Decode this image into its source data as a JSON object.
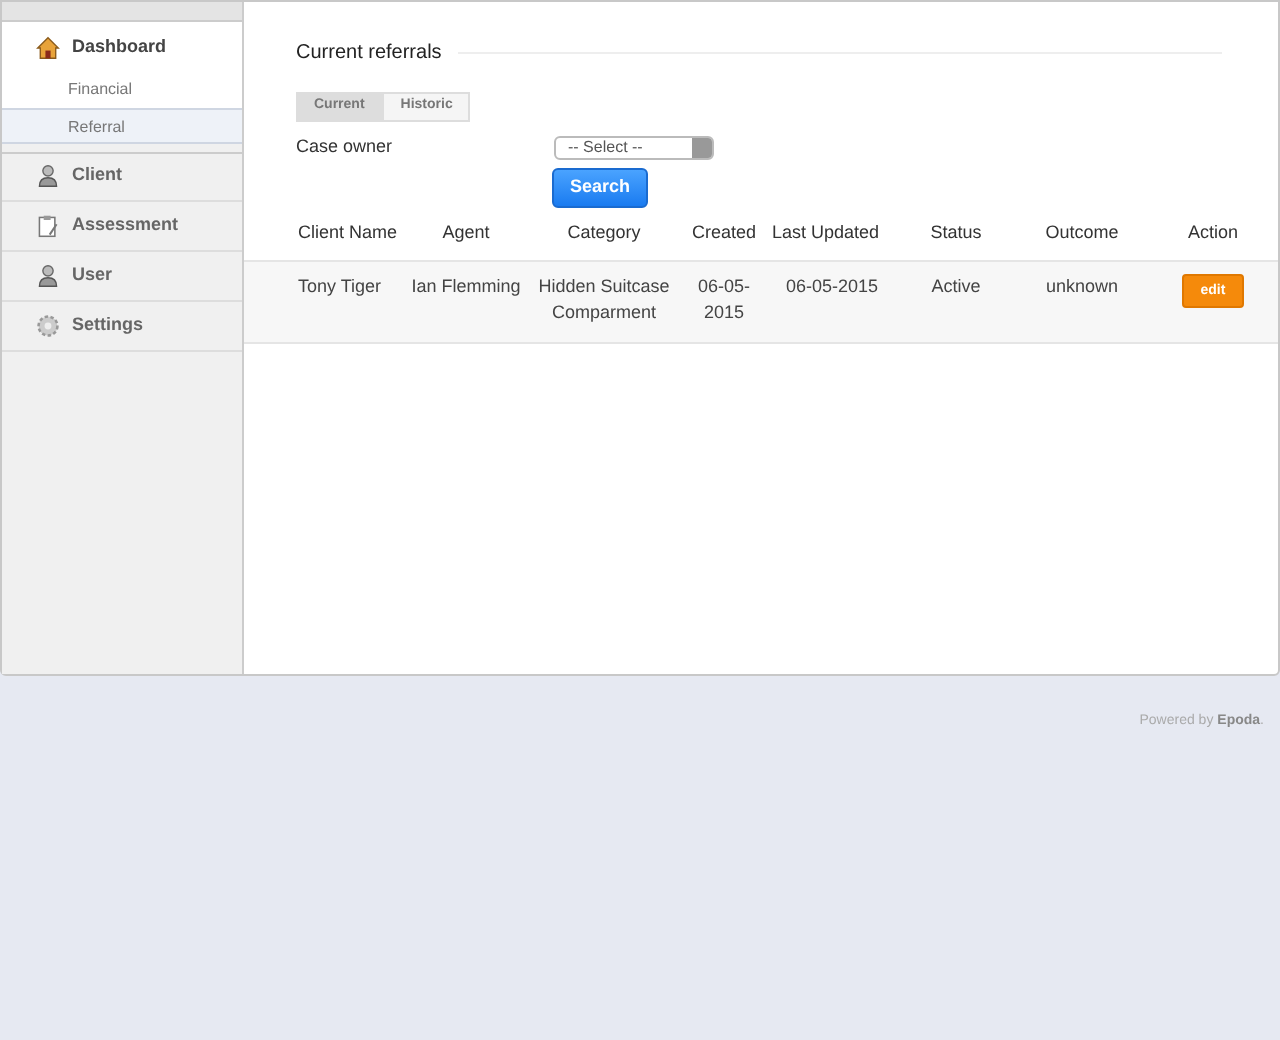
{
  "sidebar": {
    "items": [
      {
        "label": "Dashboard",
        "expanded": true,
        "children": [
          {
            "label": "Financial",
            "selected": false
          },
          {
            "label": "Referral",
            "selected": true
          }
        ]
      },
      {
        "label": "Client",
        "expanded": false
      },
      {
        "label": "Assessment",
        "expanded": false
      },
      {
        "label": "User",
        "expanded": false
      },
      {
        "label": "Settings",
        "expanded": false
      }
    ]
  },
  "section_title": "Current referrals",
  "toggle": [
    {
      "label": "Current",
      "selected": true
    },
    {
      "label": "Historic",
      "selected": false
    }
  ],
  "filter": {
    "label": "Case owner",
    "select_value": "-- Select --",
    "button": "Search"
  },
  "table": {
    "columns": [
      "Client Name",
      "Agent",
      "Category",
      "Created",
      "Last Updated",
      "Status",
      "Outcome",
      "Action"
    ],
    "rows": [
      {
        "cells": [
          "Tony Tiger",
          "Ian Flemming",
          "Hidden Suitcase Comparment",
          "06-05-2015",
          "06-05-2015",
          "Active",
          "unknown"
        ],
        "action": "edit"
      }
    ]
  },
  "footer": "Powered by **Epoda**."
}
